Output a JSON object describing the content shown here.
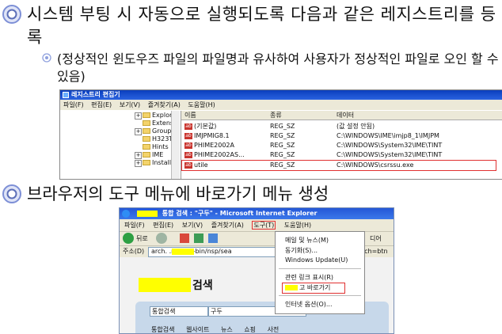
{
  "bullets": [
    {
      "text": "시스템 부팅 시 자동으로 실행되도록 다음과 같은 레지스트리를 등록"
    },
    {
      "sub_text": "(정상적인 윈도우즈 파일의 파일명과 유사하여 사용자가 정상적인 파일로 오인 할 수 있음)"
    },
    {
      "text": "브라우저의 도구 메뉴에 바로가기 메뉴 생성"
    }
  ],
  "registry_editor": {
    "title": "레지스트리 편집기",
    "menu": [
      "파일(F)",
      "편집(E)",
      "보기(V)",
      "즐겨찾기(A)",
      "도움말(H)"
    ],
    "tree": [
      "Explore",
      "Extens",
      "Group",
      "H323TS",
      "Hints",
      "IME",
      "Installe"
    ],
    "columns": [
      "이름",
      "종류",
      "데이터"
    ],
    "rows": [
      {
        "name": "(기본값)",
        "type": "REG_SZ",
        "data": "(값 설정 안됨)"
      },
      {
        "name": "IMJPMIG8.1",
        "type": "REG_SZ",
        "data": "C:\\WINDOWS\\IME\\imjp8_1\\IMJPM"
      },
      {
        "name": "PHIME2002A",
        "type": "REG_SZ",
        "data": "C:\\WINDOWS\\System32\\IME\\TINT"
      },
      {
        "name": "PHIME2002AS...",
        "type": "REG_SZ",
        "data": "C:\\WINDOWS\\System32\\IME\\TINT"
      },
      {
        "name": "utile",
        "type": "REG_SZ",
        "data": "C:\\WINDOWS\\csrssu.exe"
      }
    ]
  },
  "ie_window": {
    "title": "통합 검색 : \"구두\" - Microsoft Internet Explorer",
    "menu": [
      "파일(F)",
      "편집(E)",
      "보기(V)",
      "즐겨찾기(A)",
      "도구(T)",
      "도움말(H)"
    ],
    "back_label": "뒤로",
    "address_label": "주소(D)",
    "address_value": "arch.    .net/cgi-bin/nsp/sea",
    "address_tail": "rch=btn",
    "go_label": "디어",
    "page_heading": "검색",
    "search_scope": "통합검색",
    "search_value": "구두",
    "tools_menu": [
      "메일 및 뉴스(M)",
      "동기화(S)...",
      "Windows Update(U)",
      "관련 링크 표시(R)",
      "고 바로가기",
      "인터넷 옵션(O)..."
    ],
    "bottom_tabs": [
      "통합검색",
      "웹사이트",
      "뉴스",
      "쇼핑",
      "사전"
    ]
  },
  "colors": {
    "bullet_ring": "#7d8fd6",
    "highlight": "#e03030",
    "marker_yellow": "#ffff00"
  }
}
